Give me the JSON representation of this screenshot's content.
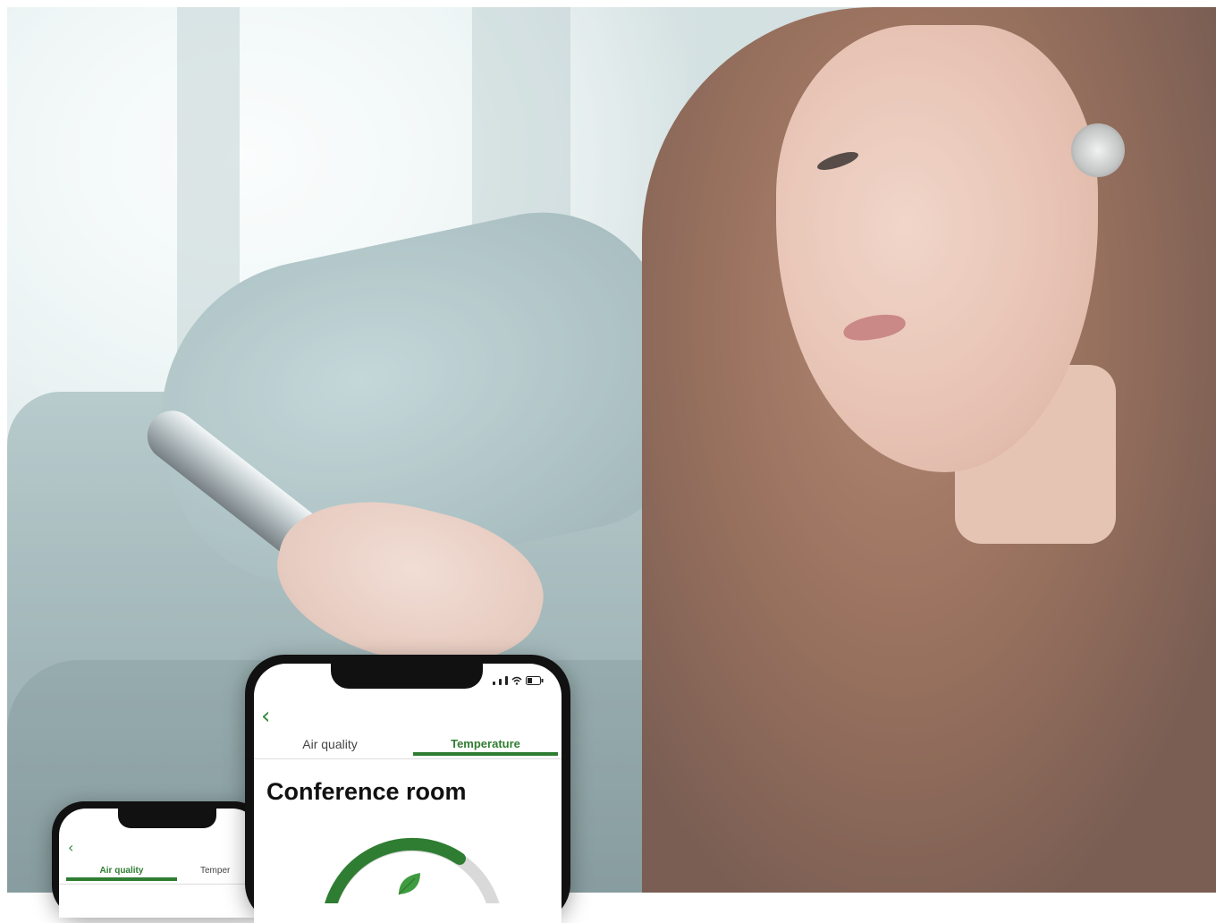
{
  "front_phone": {
    "back_icon": "chevron-left-icon",
    "tabs": [
      {
        "label": "Air quality",
        "active": false
      },
      {
        "label": "Temperature",
        "active": true
      }
    ],
    "title": "Conference room",
    "gauge": {
      "icon": "leaf-icon",
      "track_color": "#d9d9d9",
      "fill_color": "#2f7d32"
    }
  },
  "back_phone": {
    "back_icon": "chevron-left-icon",
    "tabs": [
      {
        "label": "Air quality",
        "active": true
      },
      {
        "label": "Temper",
        "active": false
      }
    ]
  },
  "colors": {
    "accent": "#2f7d32"
  }
}
